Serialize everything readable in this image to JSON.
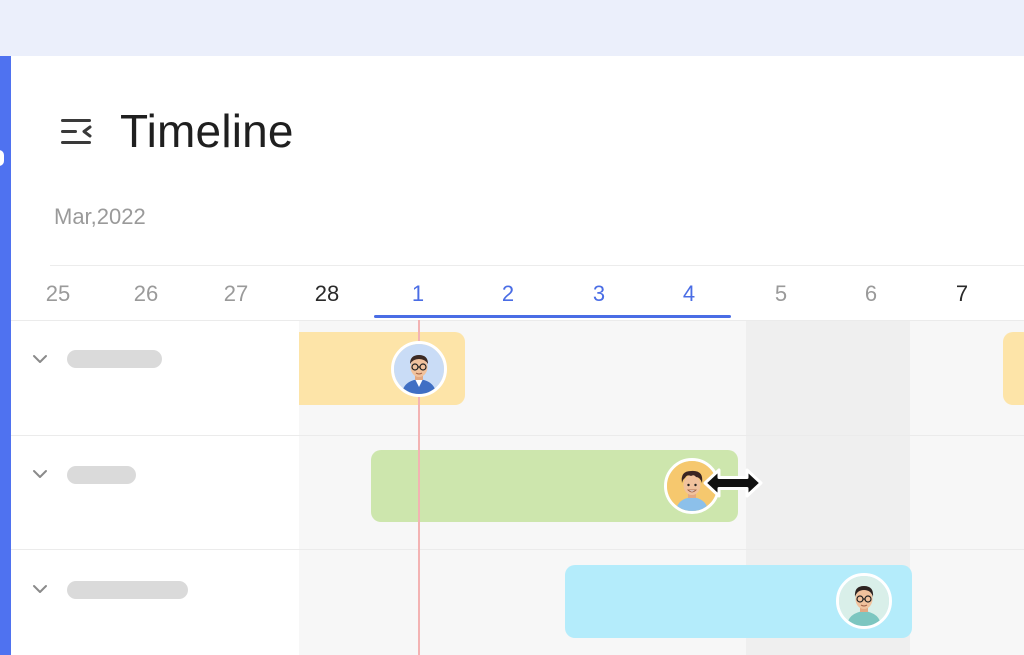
{
  "header": {
    "title": "Timeline",
    "menu_icon": "collapse-menu-icon"
  },
  "calendar": {
    "month_label": "Mar,2022",
    "days": [
      {
        "label": "25",
        "state": "normal"
      },
      {
        "label": "26",
        "state": "normal"
      },
      {
        "label": "27",
        "state": "normal"
      },
      {
        "label": "28",
        "state": "bold"
      },
      {
        "label": "1",
        "state": "selected"
      },
      {
        "label": "2",
        "state": "selected"
      },
      {
        "label": "3",
        "state": "selected"
      },
      {
        "label": "4",
        "state": "selected"
      },
      {
        "label": "5",
        "state": "normal"
      },
      {
        "label": "6",
        "state": "normal"
      },
      {
        "label": "7",
        "state": "bold"
      }
    ],
    "selected_week": [
      "1",
      "2",
      "3",
      "4"
    ],
    "today": "1",
    "weekend_days": [
      "5",
      "6"
    ]
  },
  "tasks": [
    {
      "row": 1,
      "start": "28",
      "end": "1",
      "color": "#fde4a8",
      "assignee_avatar": "man-glasses-avatar-icon"
    },
    {
      "row": 2,
      "start": "1",
      "end": "4",
      "color": "#cde6ad",
      "assignee_avatar": "man-curly-hair-avatar-icon",
      "being_resized": true
    },
    {
      "row": 3,
      "start": "3",
      "end": "6",
      "color": "#b4ecfb",
      "assignee_avatar": "man-teal-shirt-avatar-icon"
    }
  ],
  "colors": {
    "accent": "#4a6de5",
    "today_line": "#f3b3b3",
    "rail": "#4f72f0",
    "top_bar": "#ebeffb"
  },
  "cursor": {
    "icon": "horizontal-resize-cursor-icon"
  }
}
